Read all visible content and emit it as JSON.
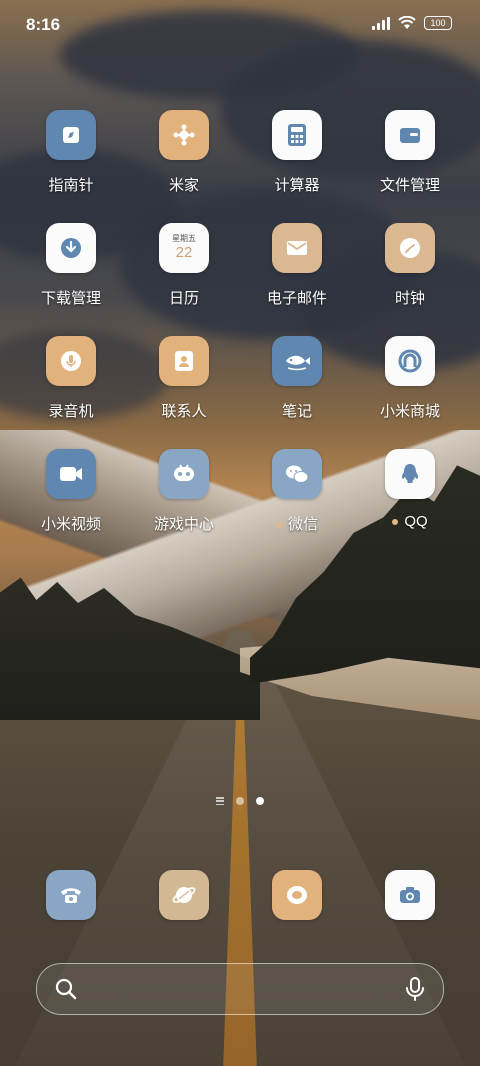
{
  "status_bar": {
    "time": "8:16",
    "battery_label": "100"
  },
  "apps": [
    {
      "label": "指南针",
      "icon": "compass-icon",
      "color": "#5f87b0"
    },
    {
      "label": "米家",
      "icon": "mijia-icon",
      "color": "#e2b27d"
    },
    {
      "label": "计算器",
      "icon": "calculator-icon",
      "color": "#fbfbfb"
    },
    {
      "label": "文件管理",
      "icon": "folder-icon",
      "color": "#fbfbfb"
    },
    {
      "label": "下载管理",
      "icon": "download-icon",
      "color": "#fbfbfb"
    },
    {
      "label": "日历",
      "icon": "calendar-icon",
      "color": "#fbfbfb",
      "weekday": "星期五",
      "day": "22"
    },
    {
      "label": "电子邮件",
      "icon": "mail-icon",
      "color": "#d9b892"
    },
    {
      "label": "时钟",
      "icon": "clock-icon",
      "color": "#d9b892"
    },
    {
      "label": "录音机",
      "icon": "microphone-icon",
      "color": "#e2b27d"
    },
    {
      "label": "联系人",
      "icon": "contacts-icon",
      "color": "#e2b27d"
    },
    {
      "label": "笔记",
      "icon": "notes-icon",
      "color": "#5f87b0"
    },
    {
      "label": "小米商城",
      "icon": "mi-store-icon",
      "color": "#fbfbfb"
    },
    {
      "label": "小米视频",
      "icon": "video-icon",
      "color": "#5f87b0"
    },
    {
      "label": "游戏中心",
      "icon": "game-center-icon",
      "color": "#89a6c4"
    },
    {
      "label": "微信",
      "icon": "wechat-icon",
      "color": "#89a6c4",
      "new": true
    },
    {
      "label": "QQ",
      "icon": "qq-icon",
      "color": "#fbfbfb",
      "new": true
    }
  ],
  "dock": [
    {
      "name": "phone",
      "icon": "phone-icon",
      "color": "#89a6c4"
    },
    {
      "name": "browser",
      "icon": "browser-planet-icon",
      "color": "#d3b896"
    },
    {
      "name": "messages",
      "icon": "messages-icon",
      "color": "#e2b27d"
    },
    {
      "name": "camera",
      "icon": "camera-icon",
      "color": "#fbfbfb"
    }
  ],
  "pager": {
    "pages": 2,
    "current": 2
  },
  "search": {
    "placeholder": ""
  }
}
